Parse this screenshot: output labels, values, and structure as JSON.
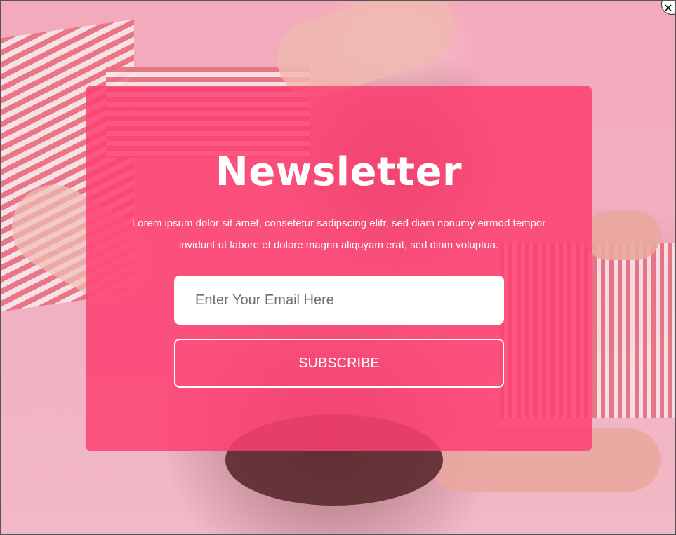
{
  "popup": {
    "title": "Newsletter",
    "description": "Lorem ipsum dolor sit amet, consetetur sadipscing elitr, sed diam nonumy eirmod tempor invidunt ut labore et dolore magna aliquyam erat, sed diam voluptua.",
    "email_placeholder": "Enter Your Email Here",
    "email_value": "",
    "subscribe_label": "SUBSCRIBE",
    "close_icon": "close-icon"
  },
  "colors": {
    "card_background": "#fd4071",
    "text": "#ffffff",
    "input_background": "#ffffff"
  }
}
